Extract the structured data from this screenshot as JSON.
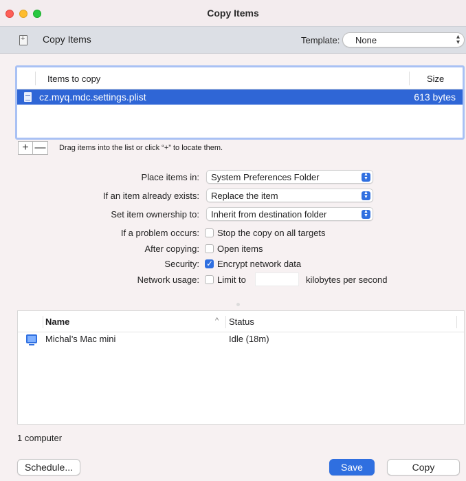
{
  "window": {
    "title": "Copy Items"
  },
  "header": {
    "title": "Copy Items",
    "template_label": "Template:",
    "template_value": "None"
  },
  "items_table": {
    "columns": [
      "Items to copy",
      "Size"
    ],
    "rows": [
      {
        "name": "cz.myq.mdc.settings.plist",
        "size": "613 bytes",
        "selected": true
      }
    ],
    "add_label": "+",
    "remove_label": "—",
    "hint": "Drag items into the list or click “+” to locate them."
  },
  "options": {
    "place_label": "Place items in:",
    "place_value": "System Preferences Folder",
    "exists_label": "If an item already exists:",
    "exists_value": "Replace the item",
    "ownership_label": "Set item ownership to:",
    "ownership_value": "Inherit from destination folder",
    "problem_label": "If a problem occurs:",
    "problem_check": "Stop the copy on all targets",
    "problem_checked": false,
    "after_label": "After copying:",
    "after_check": "Open items",
    "after_checked": false,
    "security_label": "Security:",
    "security_check": "Encrypt network data",
    "security_checked": true,
    "network_label": "Network usage:",
    "network_check": "Limit to",
    "network_checked": false,
    "network_value": "",
    "network_units": "kilobytes per second"
  },
  "computers_table": {
    "columns": [
      "Name",
      "Status"
    ],
    "sort_indicator": "^",
    "rows": [
      {
        "name": "Michal’s Mac mini",
        "status": "Idle (18m)"
      }
    ],
    "count_text": "1 computer"
  },
  "buttons": {
    "schedule": "Schedule...",
    "save": "Save",
    "copy": "Copy"
  },
  "colors": {
    "accent": "#2f6fe0",
    "selection": "#2f66d6"
  }
}
